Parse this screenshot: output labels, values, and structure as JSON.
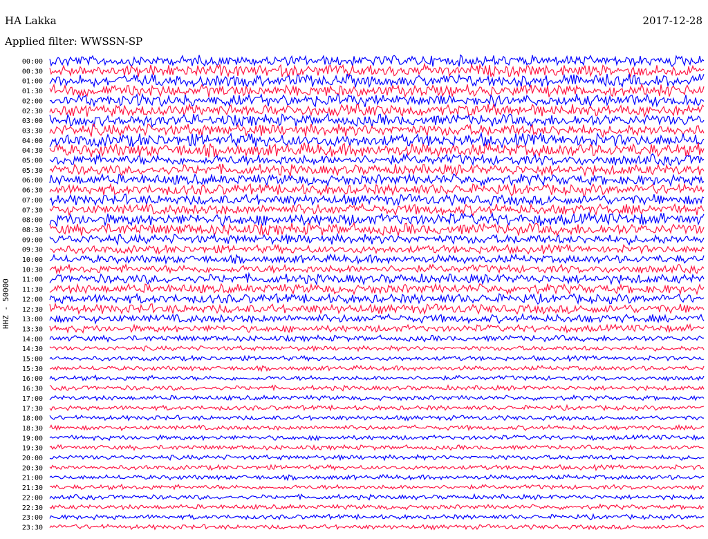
{
  "header": {
    "station": "HA Lakka",
    "date": "2017-12-28",
    "filter": "Applied filter: WWSSN-SP"
  },
  "chart_data": {
    "type": "line",
    "channel_label": "HHZ - 50000",
    "time_labels": [
      "00:00",
      "00:30",
      "01:00",
      "01:30",
      "02:00",
      "02:30",
      "03:00",
      "03:30",
      "04:00",
      "04:30",
      "05:00",
      "05:30",
      "06:00",
      "06:30",
      "07:00",
      "07:30",
      "08:00",
      "08:30",
      "09:00",
      "09:30",
      "10:00",
      "10:30",
      "11:00",
      "11:30",
      "12:00",
      "12:30",
      "13:00",
      "13:30",
      "14:00",
      "14:30",
      "15:00",
      "15:30",
      "16:00",
      "16:30",
      "17:00",
      "17:30",
      "18:00",
      "18:30",
      "19:00",
      "19:30",
      "20:00",
      "20:30",
      "21:00",
      "21:30",
      "22:00",
      "22:30",
      "23:00",
      "23:30"
    ],
    "trace_colors": [
      "#0000ff",
      "#ff1744"
    ],
    "noise_level": [
      9,
      10,
      10,
      10,
      10,
      10,
      10,
      10,
      11,
      11,
      9,
      9,
      9,
      9,
      9,
      9,
      10,
      10,
      8,
      7,
      7,
      7,
      8,
      8,
      8,
      8,
      7,
      6,
      5,
      4,
      4,
      4,
      4,
      4,
      4,
      4,
      4,
      4,
      4,
      4,
      4,
      4,
      4,
      4,
      4,
      4,
      4,
      4
    ],
    "grid": false
  }
}
